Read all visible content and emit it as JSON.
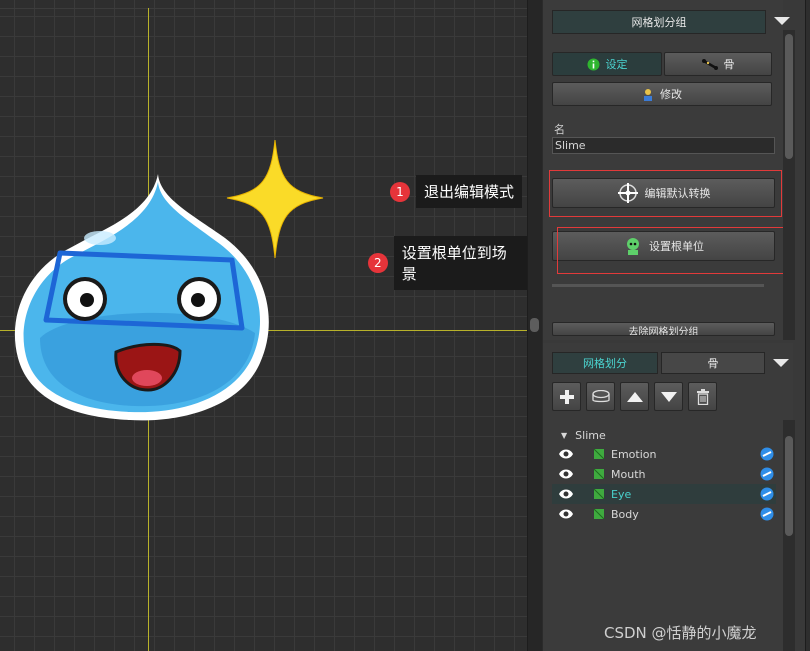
{
  "viewport": {
    "callouts": [
      {
        "number": "1",
        "label": "退出编辑模式"
      },
      {
        "number": "2",
        "label": "设置根单位到场景"
      }
    ]
  },
  "mesh_group_panel": {
    "header": "网格划分组",
    "tabs": [
      {
        "label": "设定",
        "icon": "info-icon",
        "active": true
      },
      {
        "label": "骨",
        "icon": "bone-icon",
        "active": false
      }
    ],
    "modify_button": "修改",
    "name_label": "名",
    "name_value": "Slime",
    "edit_default_transform_button": "编辑默认转换",
    "set_root_unit_button": "设置根单位",
    "partial_button": "去除网格划分组"
  },
  "mesh_panel": {
    "tabs": [
      {
        "label": "网格划分",
        "active": true
      },
      {
        "label": "骨",
        "active": false
      }
    ],
    "toolbar": [
      "add-icon",
      "mesh-layer-icon",
      "move-up-icon",
      "move-down-icon",
      "delete-icon"
    ],
    "tree": {
      "root": "Slime",
      "items": [
        {
          "label": "Emotion",
          "selected": false
        },
        {
          "label": "Mouth",
          "selected": false
        },
        {
          "label": "Eye",
          "selected": true
        },
        {
          "label": "Body",
          "selected": false
        }
      ]
    }
  },
  "watermark": "CSDN @恬静的小魔龙",
  "colors": {
    "accent": "#4bd4d0",
    "callout_badge": "#e6343a",
    "highlight_box": "#e23a3a",
    "axis": "#b8b22a"
  }
}
